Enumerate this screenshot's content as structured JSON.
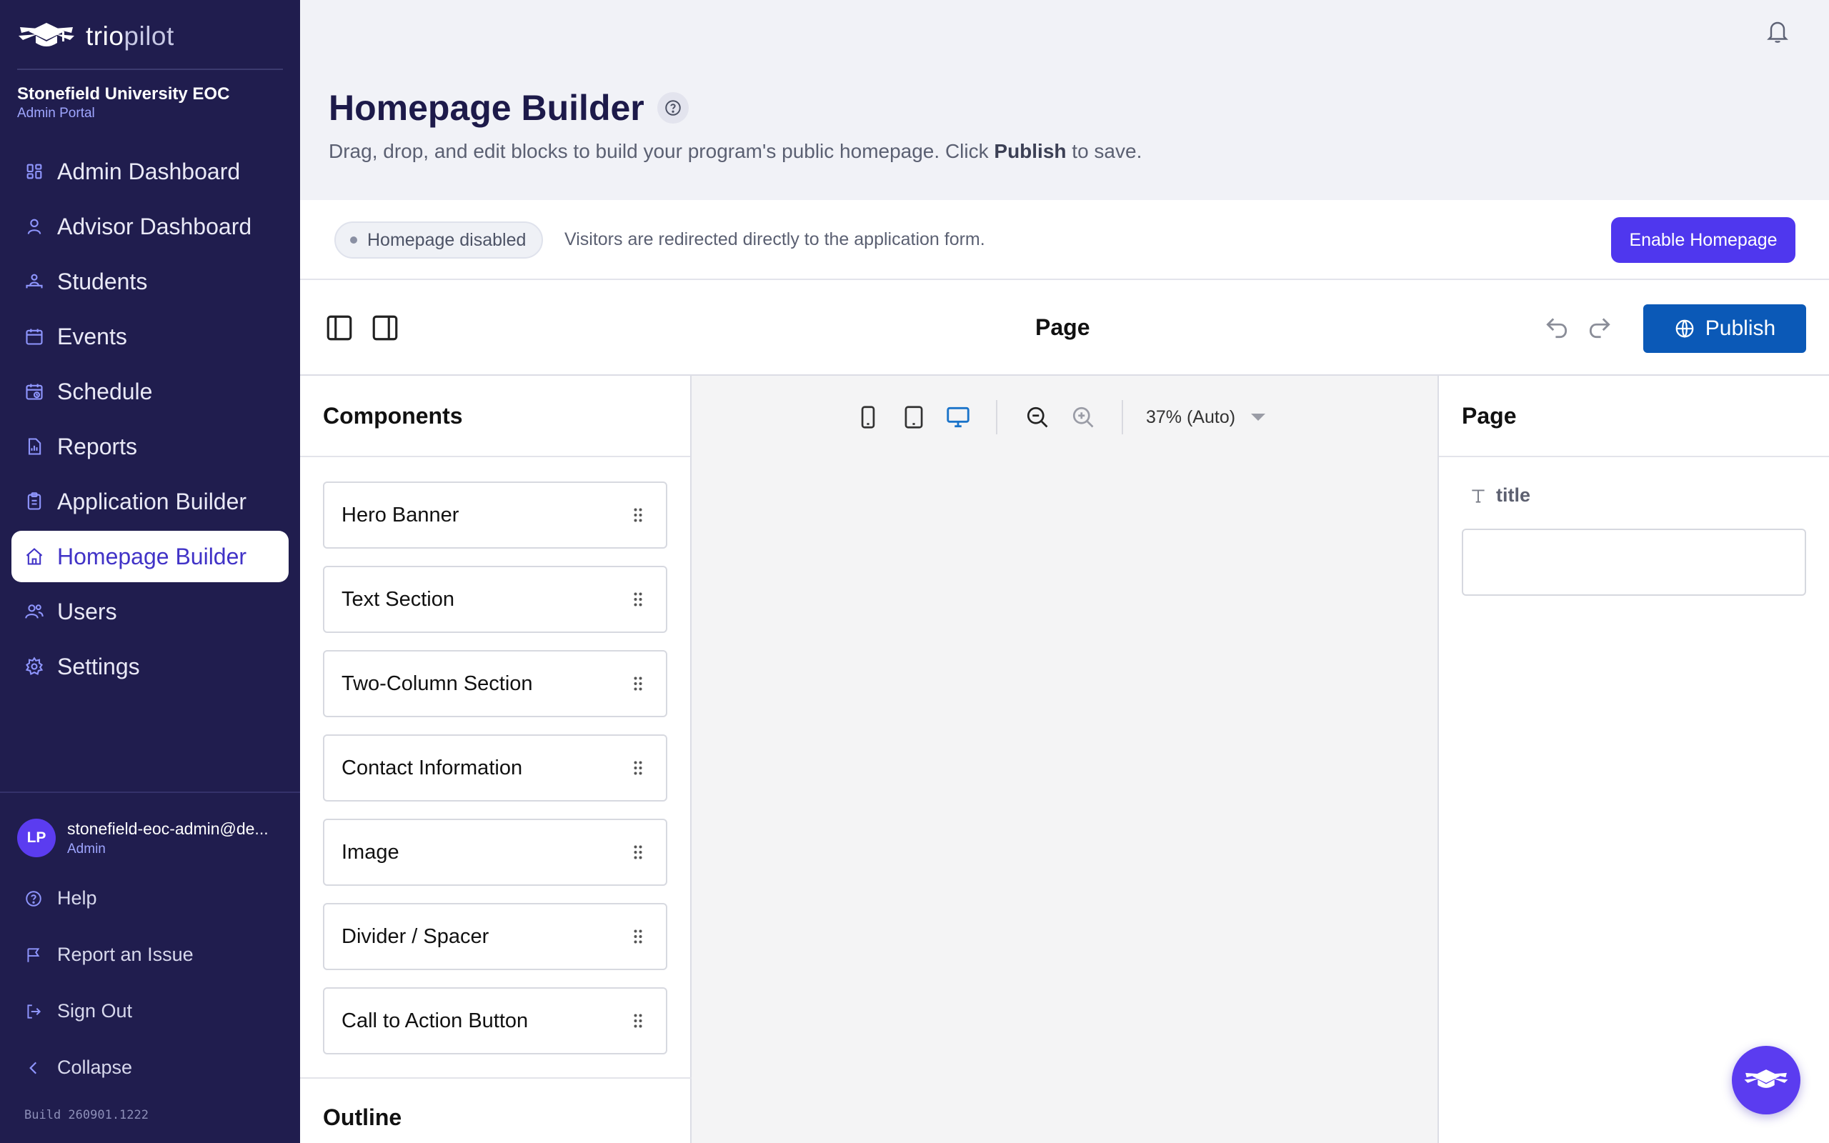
{
  "brand": {
    "name_bold": "trio",
    "name_light": "pilot"
  },
  "org": {
    "name": "Stonefield University EOC",
    "portal": "Admin Portal"
  },
  "nav": {
    "items": [
      {
        "label": "Admin Dashboard",
        "icon": "grid-icon"
      },
      {
        "label": "Advisor Dashboard",
        "icon": "user-icon"
      },
      {
        "label": "Students",
        "icon": "students-icon"
      },
      {
        "label": "Events",
        "icon": "calendar-icon"
      },
      {
        "label": "Schedule",
        "icon": "calendar-clock-icon"
      },
      {
        "label": "Reports",
        "icon": "report-icon"
      },
      {
        "label": "Application Builder",
        "icon": "clipboard-icon"
      },
      {
        "label": "Homepage Builder",
        "icon": "home-icon",
        "active": true
      },
      {
        "label": "Users",
        "icon": "users-icon"
      },
      {
        "label": "Settings",
        "icon": "gear-icon"
      }
    ]
  },
  "user": {
    "initials": "LP",
    "email": "stonefield-eoc-admin@de...",
    "role": "Admin"
  },
  "side_links": {
    "help": "Help",
    "report": "Report an Issue",
    "signout": "Sign Out",
    "collapse": "Collapse"
  },
  "build": "Build 260901.1222",
  "header": {
    "title": "Homepage Builder",
    "subtitle_pre": "Drag, drop, and edit blocks to build your program's public homepage. Click ",
    "subtitle_bold": "Publish",
    "subtitle_post": " to save."
  },
  "notice": {
    "badge": "Homepage disabled",
    "text": "Visitors are redirected directly to the application form.",
    "button": "Enable Homepage"
  },
  "toolbar": {
    "title": "Page",
    "publish": "Publish"
  },
  "components": {
    "title": "Components",
    "items": [
      "Hero Banner",
      "Text Section",
      "Two-Column Section",
      "Contact Information",
      "Image",
      "Divider / Spacer",
      "Call to Action Button"
    ],
    "outline_title": "Outline"
  },
  "canvas": {
    "zoom_label": "37% (Auto)"
  },
  "properties": {
    "title": "Page",
    "field_label": "title",
    "field_value": ""
  },
  "colors": {
    "sidebar": "#201d4e",
    "accent": "#4f37ee",
    "publish": "#0b59b7"
  }
}
